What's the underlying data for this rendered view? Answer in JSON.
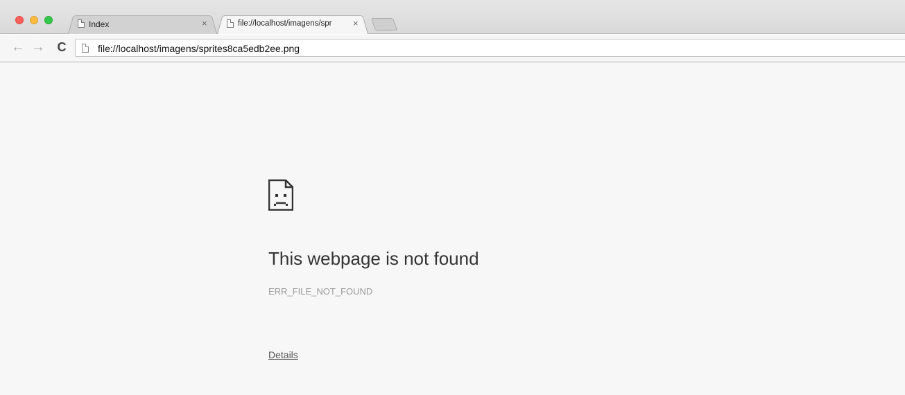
{
  "tabs": [
    {
      "title": "Index",
      "close": "×",
      "active": false
    },
    {
      "title": "file://localhost/imagens/spr",
      "close": "×",
      "active": true
    }
  ],
  "toolbar": {
    "back_glyph": "←",
    "forward_glyph": "→",
    "reload_glyph": "C",
    "url": "file://localhost/imagens/sprites8ca5edb2ee.png"
  },
  "error": {
    "icon": "sad-page-icon",
    "title": "This webpage is not found",
    "code": "ERR_FILE_NOT_FOUND",
    "details_link": "Details"
  },
  "colors": {
    "close_red": "#fc605b",
    "minimize_yellow": "#fdbc40",
    "zoom_green": "#34c84a",
    "page_background": "#f7f7f7"
  }
}
